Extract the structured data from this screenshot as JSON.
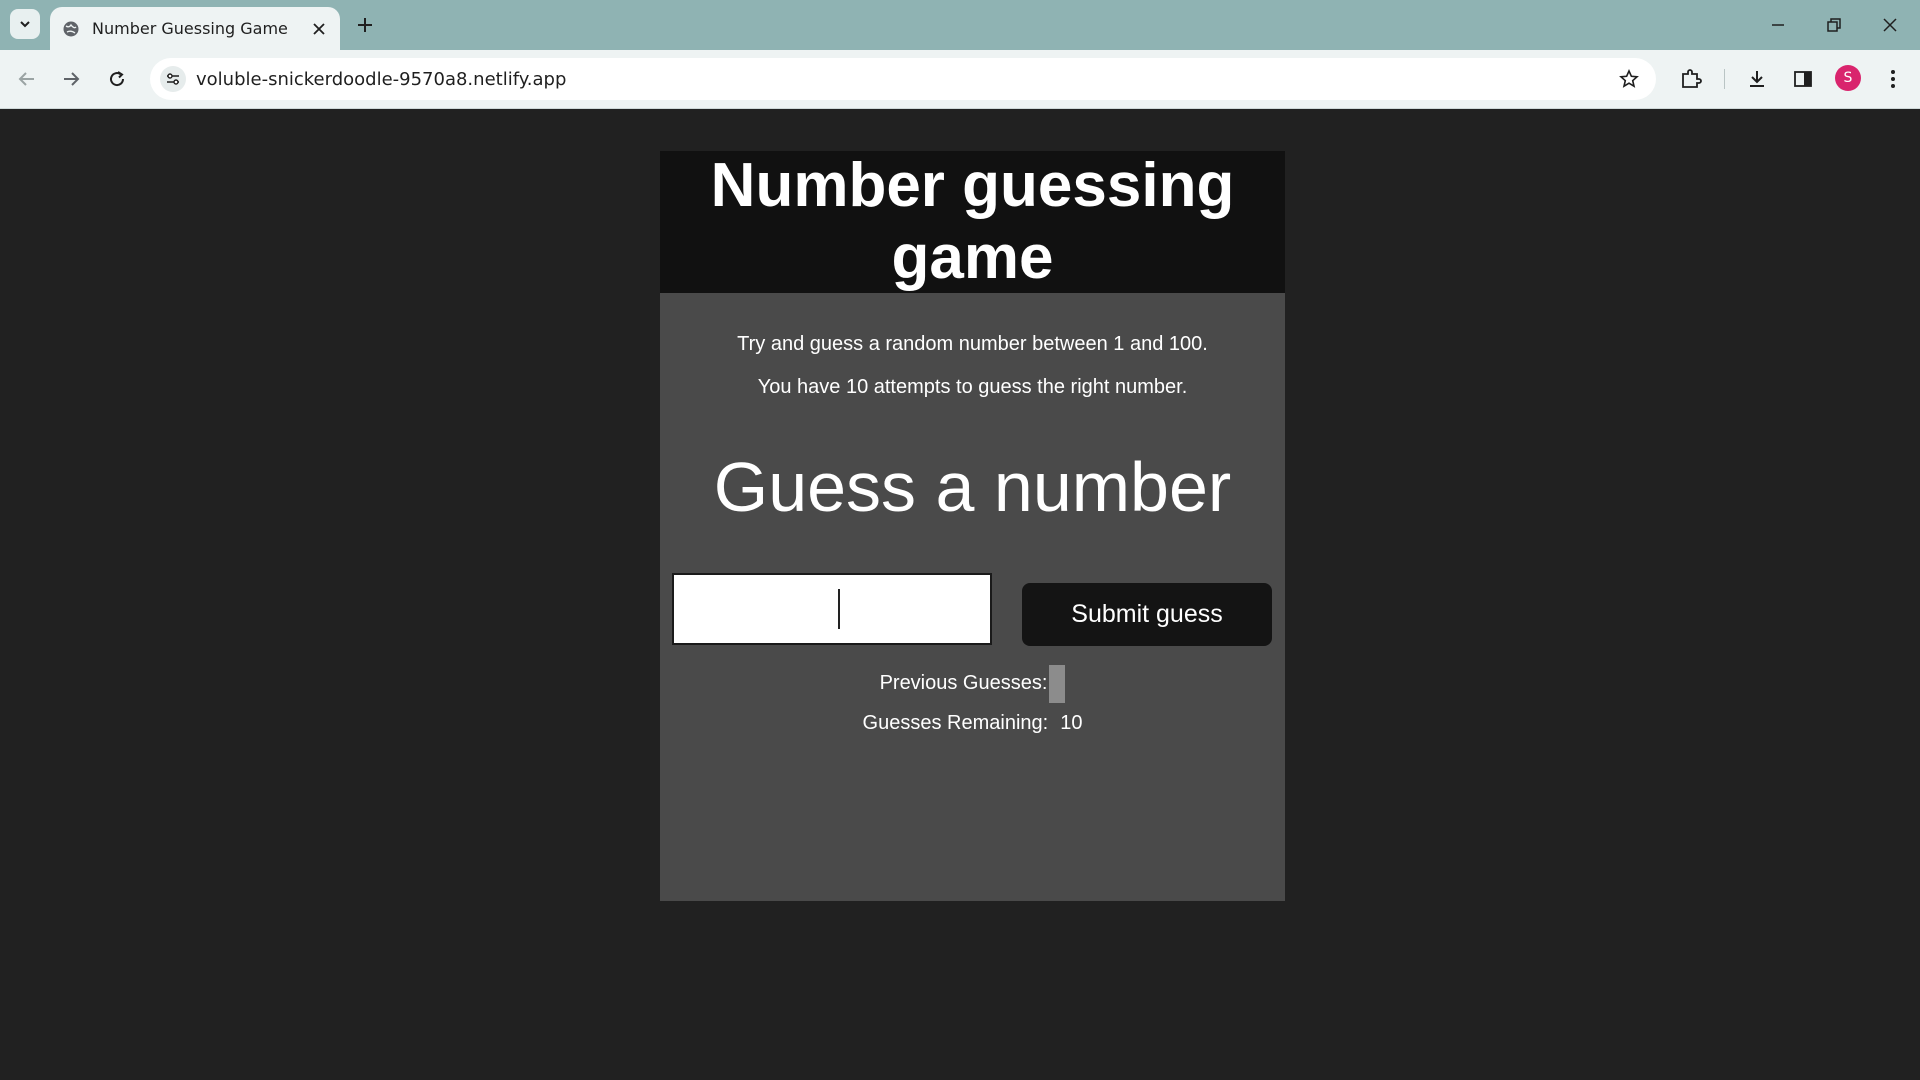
{
  "browser": {
    "tab_title": "Number Guessing Game",
    "url": "voluble-snickerdoodle-9570a8.netlify.app",
    "profile_initial": "S"
  },
  "game": {
    "title": "Number guessing game",
    "intro_line1": "Try and guess a random number between 1 and 100.",
    "intro_line2": "You have 10 attempts to guess the right number.",
    "heading": "Guess a number",
    "guess_input_value": "",
    "submit_label": "Submit guess",
    "previous_guesses_label": "Previous Guesses:",
    "previous_guesses_value": "",
    "remaining_label": "Guesses Remaining:",
    "remaining_value": "10"
  },
  "colors": {
    "page_bg": "#212121",
    "panel_bg": "#4a4a4a",
    "header_bg": "#111111",
    "button_bg": "#141414",
    "tabstrip_bg": "#8fb3b3"
  }
}
